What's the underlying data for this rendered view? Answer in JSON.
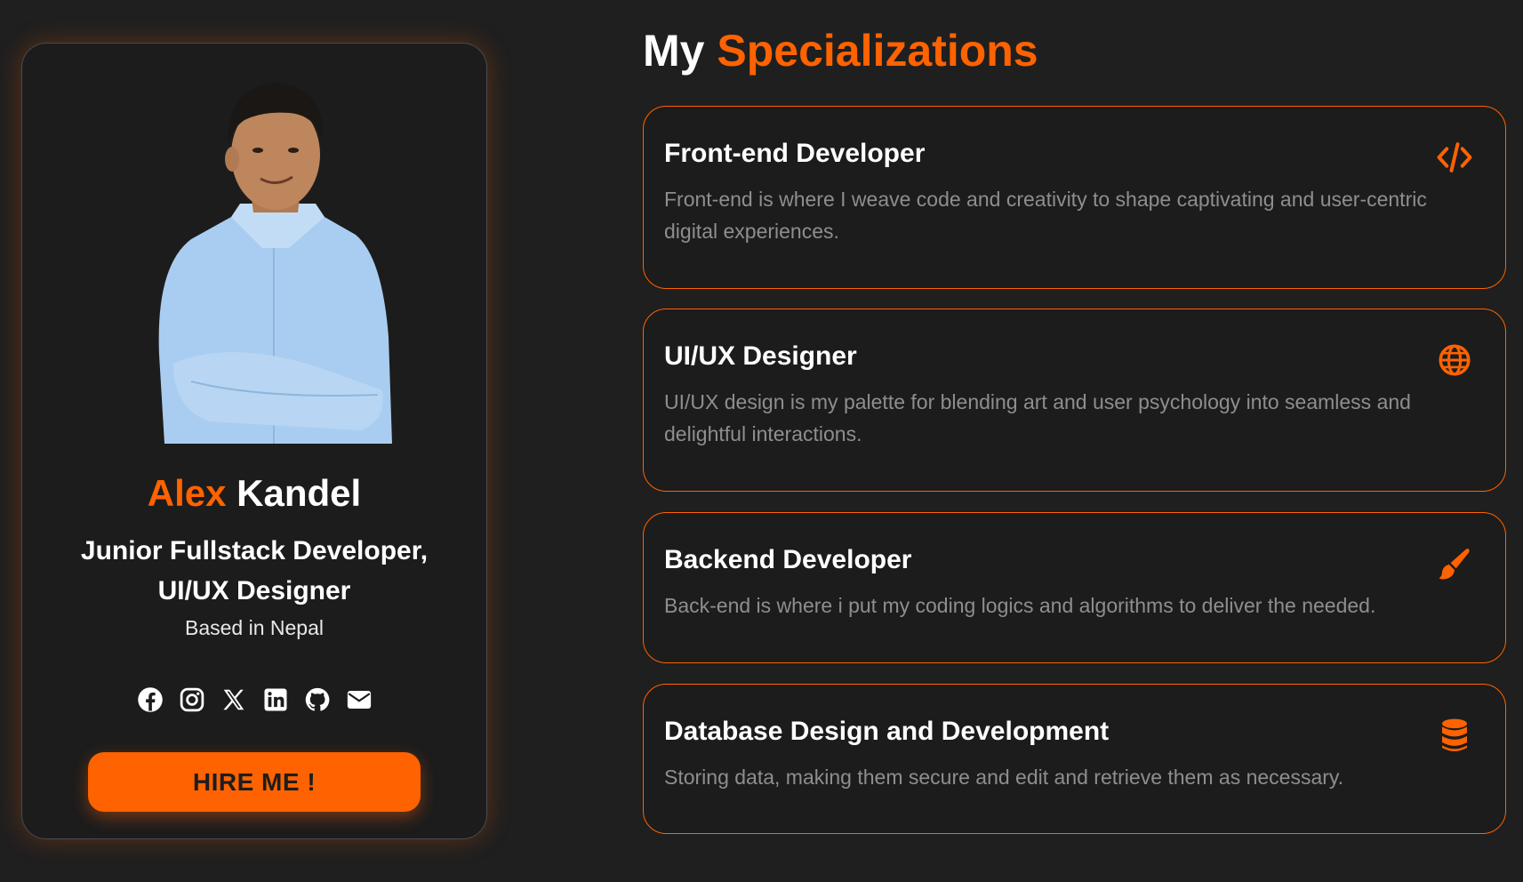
{
  "profile": {
    "first_name": "Alex",
    "last_name": "Kandel",
    "role": "Junior Fullstack Developer, UI/UX Designer",
    "location": "Based in Nepal",
    "hire_label": "HIRE ME !",
    "socials": [
      "facebook-icon",
      "instagram-icon",
      "x-icon",
      "linkedin-icon",
      "github-icon",
      "email-icon"
    ]
  },
  "section": {
    "title_plain": "My",
    "title_accent": "Specializations"
  },
  "specializations": [
    {
      "title": "Front-end Developer",
      "description": "Front-end is where I weave code and creativity to shape captivating and user-centric digital experiences.",
      "icon": "code-icon"
    },
    {
      "title": "UI/UX Designer",
      "description": "UI/UX design is my palette for blending art and user psychology into seamless and delightful interactions.",
      "icon": "globe-icon"
    },
    {
      "title": "Backend Developer",
      "description": "Back-end is where i put my coding logics and algorithms to deliver the needed.",
      "icon": "brush-icon"
    },
    {
      "title": "Database Design and Development",
      "description": "Storing data, making them secure and edit and retrieve them as necessary.",
      "icon": "database-icon"
    }
  ],
  "colors": {
    "accent": "#ff6200",
    "background": "#1f1f1f",
    "card": "#1c1c1c",
    "muted_text": "#8e8e8e"
  }
}
